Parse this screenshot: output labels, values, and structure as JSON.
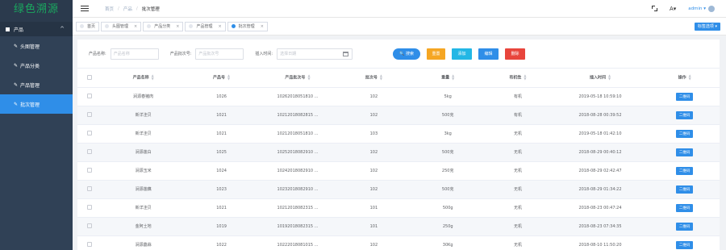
{
  "app": {
    "logo": "绿色溯源"
  },
  "sidebar": {
    "group": {
      "label": "产品",
      "chevron": "^"
    },
    "items": [
      {
        "label": "头图管理",
        "active": false
      },
      {
        "label": "产品分类",
        "active": false
      },
      {
        "label": "产品管理",
        "active": false
      },
      {
        "label": "批次管理",
        "active": true
      }
    ]
  },
  "topbar": {
    "breadcrumb": [
      "首页",
      "产品",
      "批次管理"
    ],
    "user": "admin ▾"
  },
  "tags": [
    {
      "label": "首页",
      "closable": false,
      "active": false
    },
    {
      "label": "头图管理",
      "closable": true,
      "active": false
    },
    {
      "label": "产品分类",
      "closable": true,
      "active": false
    },
    {
      "label": "产品管理",
      "closable": true,
      "active": false
    },
    {
      "label": "批次管理",
      "closable": true,
      "active": true
    }
  ],
  "tag_options_label": "标签选项 ▾",
  "search": {
    "name_label": "产品名称:",
    "name_placeholder": "产品名称",
    "batch_label": "产品批次号:",
    "batch_placeholder": "产品批次号",
    "time_label": "插入时间:",
    "time_placeholder": "选择日期",
    "search_button": "🔍 搜索",
    "reset_button": "重置",
    "add_button": "添加",
    "edit_button": "编辑",
    "delete_button": "删除"
  },
  "table": {
    "columns": [
      "产品名称",
      "产品号",
      "产品批次号",
      "批次号",
      "重量",
      "有机性",
      "插入时间",
      "操作"
    ],
    "action_label": "二维码",
    "rows": [
      [
        "涧源春猪肉",
        "1026",
        "10262018051810 ...",
        "102",
        "5kg",
        "有机",
        "2019-05-18 10:59:10",
        ""
      ],
      [
        "新洋洼贝",
        "1021",
        "10212018082815 ...",
        "102",
        "500克",
        "有机",
        "2018-08-28 00:39:52",
        ""
      ],
      [
        "新洋洼贝",
        "1021",
        "10212018051810 ...",
        "103",
        "3kg",
        "无机",
        "2019-05-18 01:42:10",
        ""
      ],
      [
        "涧源莲白",
        "1025",
        "10252018082910 ...",
        "102",
        "500克",
        "无机",
        "2018-08-29 00:40:12",
        ""
      ],
      [
        "涧源玉米",
        "1024",
        "10242018082910 ...",
        "102",
        "250克",
        "无机",
        "2018-08-29 02:42:47",
        ""
      ],
      [
        "涧源莲藕",
        "1023",
        "10232018082910 ...",
        "102",
        "500克",
        "无机",
        "2018-08-29 01:34:22",
        ""
      ],
      [
        "新洋洼贝",
        "1021",
        "10212018082315 ...",
        "101",
        "500g",
        "无机",
        "2018-08-23 00:47:24",
        ""
      ],
      [
        "金阿土地",
        "1019",
        "10192018082315 ...",
        "101",
        "250g",
        "无机",
        "2018-08-23 07:34:35",
        ""
      ],
      [
        "涧源藠蒜",
        "1022",
        "10222018081015 ...",
        "102",
        "30Kg",
        "无机",
        "2018-08-10 11:50:20",
        ""
      ]
    ]
  }
}
